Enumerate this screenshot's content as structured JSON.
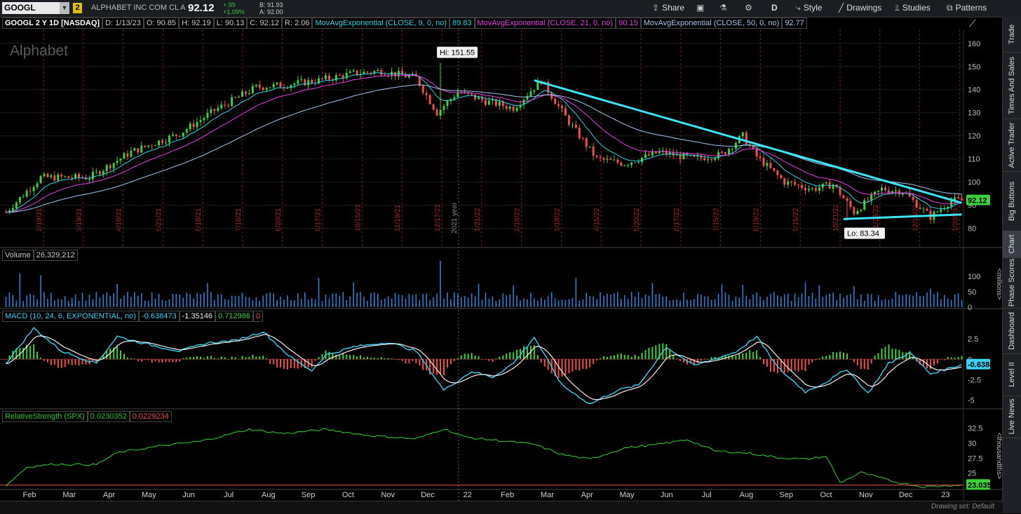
{
  "toolbar": {
    "symbol": "GOOGL",
    "link_badge": "2",
    "company": "ALPHABET INC COM CL A",
    "last": "92.12",
    "change": "+.99",
    "change_pct": "+1.09%",
    "bid": "B: 91.93",
    "ask": "A: 92.00",
    "share_label": "Share",
    "period_label": "D",
    "style_label": "Style",
    "drawings_label": "Drawings",
    "studies_label": "Studies",
    "patterns_label": "Patterns"
  },
  "legend": {
    "title": "GOOGL 2 Y 1D [NASDAQ]",
    "date": "D: 1/13/23",
    "open": "O: 90.85",
    "high": "H: 92.19",
    "low": "L: 90.13",
    "close": "C: 92.12",
    "range": "R: 2.06",
    "ema9_label": "MovAvgExponential (CLOSE, 9, 0, no)",
    "ema9_value": "89.83",
    "ema21_label": "MovAvgExponential (CLOSE, 21, 0, no)",
    "ema21_value": "90.15",
    "ema50_label": "MovAvgExponential (CLOSE, 50, 0, no)",
    "ema50_value": "92.77"
  },
  "colors": {
    "up": "#3cd23c",
    "down": "#f05050",
    "ema9": "#30d0e0",
    "ema21": "#e040e0",
    "ema50": "#a0c8f0",
    "trendline": "#3de3f0",
    "volume": "#2d7fd0",
    "macd": "#3ad0f0",
    "signal": "#f0f0f0",
    "rs": "#30c030"
  },
  "sidebar": {
    "tabs": [
      "Trade",
      "Times And Sales",
      "Active Trader",
      "Big Buttons",
      "Chart",
      "Phase Scores",
      "Dashboard",
      "Level II",
      "Live News"
    ]
  },
  "volume_pane": {
    "label": "Volume",
    "value": "26,329,212",
    "unit": "<millions>"
  },
  "macd_pane": {
    "label": "MACD (10, 24, 6, EXPONENTIAL, no)",
    "value": "-0.638473",
    "avg": "-1.35146",
    "diff": "0.712986",
    "zero": "0",
    "badge": "-0.6384"
  },
  "rs_pane": {
    "label": "RelativeStrength (SPX)",
    "value": "0.0230352",
    "avg": "0.0229234",
    "unit": "<thousandths>",
    "badge": "23.0352"
  },
  "status": {
    "drawing_set": "Drawing set: Default"
  },
  "chart_data": {
    "type": "candlestick",
    "watermark": "Alphabet",
    "price_axis": {
      "ticks": [
        80,
        90,
        100,
        110,
        120,
        130,
        140,
        150,
        160
      ],
      "range": [
        72,
        166
      ]
    },
    "last_price_badge": "92.12",
    "annotations": {
      "high": "Hi: 151.55",
      "low": "Lo: 83.34",
      "year_marker": "2021 year"
    },
    "vertical_date_labels": [
      "2/19/21",
      "3/19/21",
      "4/16/21",
      "5/21/21",
      "6/18/21",
      "7/16/21",
      "8/20/21",
      "9/17/21",
      "10/15/21",
      "11/19/21",
      "12/17/21",
      "1/21/22",
      "2/18/22",
      "3/18/22",
      "4/15/22",
      "5/20/22",
      "6/17/22",
      "7/15/22",
      "8/19/22",
      "9/16/22",
      "10/21/22",
      "11/18/22",
      "12/16/22",
      "1/20/23"
    ],
    "x_axis_labels": [
      "Feb",
      "Mar",
      "Apr",
      "May",
      "Jun",
      "Jul",
      "Aug",
      "Sep",
      "Oct",
      "Nov",
      "Dec",
      "22",
      "Feb",
      "Mar",
      "Apr",
      "May",
      "Jun",
      "Jul",
      "Aug",
      "Sep",
      "Oct",
      "Nov",
      "Dec",
      "23"
    ],
    "price_path": [
      [
        0,
        87
      ],
      [
        10,
        102
      ],
      [
        24,
        102
      ],
      [
        36,
        113
      ],
      [
        50,
        121
      ],
      [
        60,
        131
      ],
      [
        72,
        141
      ],
      [
        80,
        142
      ],
      [
        90,
        144
      ],
      [
        100,
        147
      ],
      [
        108,
        148
      ],
      [
        118,
        145
      ],
      [
        124,
        130
      ],
      [
        130,
        139
      ],
      [
        138,
        135
      ],
      [
        146,
        132
      ],
      [
        154,
        144
      ],
      [
        162,
        126
      ],
      [
        170,
        110
      ],
      [
        178,
        108
      ],
      [
        188,
        113
      ],
      [
        198,
        110
      ],
      [
        206,
        112
      ],
      [
        212,
        120
      ],
      [
        216,
        111
      ],
      [
        224,
        100
      ],
      [
        232,
        97
      ],
      [
        238,
        99
      ],
      [
        244,
        87
      ],
      [
        252,
        97
      ],
      [
        258,
        96
      ],
      [
        266,
        85
      ],
      [
        272,
        92
      ]
    ],
    "price_spikes": {
      "high": [
        125,
        151.55
      ],
      "low": [
        242,
        83.34
      ]
    },
    "trendlines": [
      {
        "name": "resistance",
        "from": [
          152,
          144
        ],
        "to": [
          275,
          91
        ]
      },
      {
        "name": "support",
        "from": [
          241,
          84
        ],
        "to": [
          275,
          86
        ]
      }
    ],
    "volume_axis": {
      "ticks": [
        0,
        50,
        100
      ],
      "range": [
        0,
        150
      ]
    },
    "macd_axis": {
      "ticks": [
        -5,
        -2.5,
        0,
        2.5
      ],
      "range": [
        -6,
        4.5
      ]
    },
    "macd_path": [
      [
        0,
        -0.5
      ],
      [
        8,
        3.8
      ],
      [
        16,
        1
      ],
      [
        26,
        -0.5
      ],
      [
        32,
        2.8
      ],
      [
        40,
        1.9
      ],
      [
        50,
        1
      ],
      [
        58,
        2
      ],
      [
        66,
        2.3
      ],
      [
        74,
        3.4
      ],
      [
        82,
        0.2
      ],
      [
        88,
        -1.4
      ],
      [
        92,
        0.5
      ],
      [
        100,
        1.5
      ],
      [
        110,
        2.1
      ],
      [
        118,
        1
      ],
      [
        126,
        -3.8
      ],
      [
        134,
        -1.5
      ],
      [
        140,
        -2.2
      ],
      [
        146,
        -0.5
      ],
      [
        152,
        2.7
      ],
      [
        160,
        -3.2
      ],
      [
        168,
        -5.5
      ],
      [
        176,
        -3.8
      ],
      [
        182,
        -3.2
      ],
      [
        190,
        1.5
      ],
      [
        198,
        -0.8
      ],
      [
        210,
        0.9
      ],
      [
        216,
        2.8
      ],
      [
        222,
        -1
      ],
      [
        230,
        -4
      ],
      [
        236,
        -2.8
      ],
      [
        242,
        -1.2
      ],
      [
        248,
        -4.2
      ],
      [
        254,
        -0.5
      ],
      [
        260,
        0.8
      ],
      [
        266,
        -1.8
      ],
      [
        275,
        -0.64
      ]
    ],
    "rs_axis": {
      "ticks": [
        25,
        27.5,
        30,
        32.5
      ],
      "range": [
        22.5,
        33.5
      ]
    },
    "rs_path": [
      [
        0,
        22.9
      ],
      [
        6,
        26
      ],
      [
        14,
        26.5
      ],
      [
        26,
        26.4
      ],
      [
        32,
        28.4
      ],
      [
        44,
        29.5
      ],
      [
        56,
        30.3
      ],
      [
        70,
        32.3
      ],
      [
        80,
        31.6
      ],
      [
        92,
        32.3
      ],
      [
        104,
        31.3
      ],
      [
        118,
        30.7
      ],
      [
        126,
        32.4
      ],
      [
        132,
        31
      ],
      [
        144,
        30.3
      ],
      [
        152,
        29.8
      ],
      [
        160,
        28.1
      ],
      [
        168,
        27.3
      ],
      [
        178,
        29.2
      ],
      [
        188,
        29.8
      ],
      [
        196,
        30.6
      ],
      [
        204,
        28.7
      ],
      [
        214,
        28.3
      ],
      [
        222,
        27.6
      ],
      [
        230,
        27.3
      ],
      [
        236,
        27.8
      ],
      [
        240,
        23.4
      ],
      [
        246,
        25.1
      ],
      [
        256,
        23.5
      ],
      [
        264,
        22.7
      ],
      [
        275,
        23.04
      ]
    ]
  }
}
